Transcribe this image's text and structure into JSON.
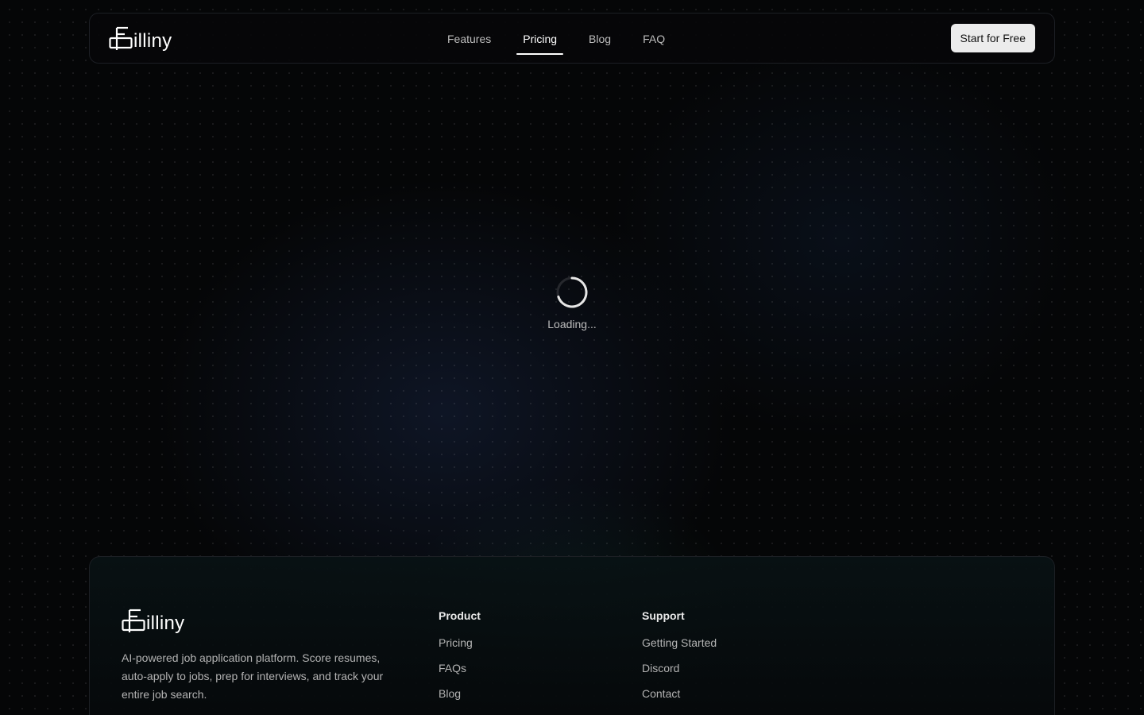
{
  "brand": {
    "name": "illiny"
  },
  "nav": {
    "links": [
      {
        "label": "Features",
        "active": false
      },
      {
        "label": "Pricing",
        "active": true
      },
      {
        "label": "Blog",
        "active": false
      },
      {
        "label": "FAQ",
        "active": false
      }
    ],
    "cta_label": "Start for Free"
  },
  "main": {
    "loading_text": "Loading..."
  },
  "footer": {
    "description": "AI-powered job application platform. Score resumes, auto-apply to jobs, prep for interviews, and track your entire job search.",
    "product": {
      "title": "Product",
      "links": [
        "Pricing",
        "FAQs",
        "Blog"
      ]
    },
    "support": {
      "title": "Support",
      "links": [
        "Getting Started",
        "Discord",
        "Contact"
      ]
    }
  },
  "colors": {
    "background": "#050607",
    "cta_bg": "#ececec",
    "text_muted": "#bdbdbd"
  },
  "icons": {
    "logo": "logo-icon",
    "spinner": "spinner-icon"
  }
}
